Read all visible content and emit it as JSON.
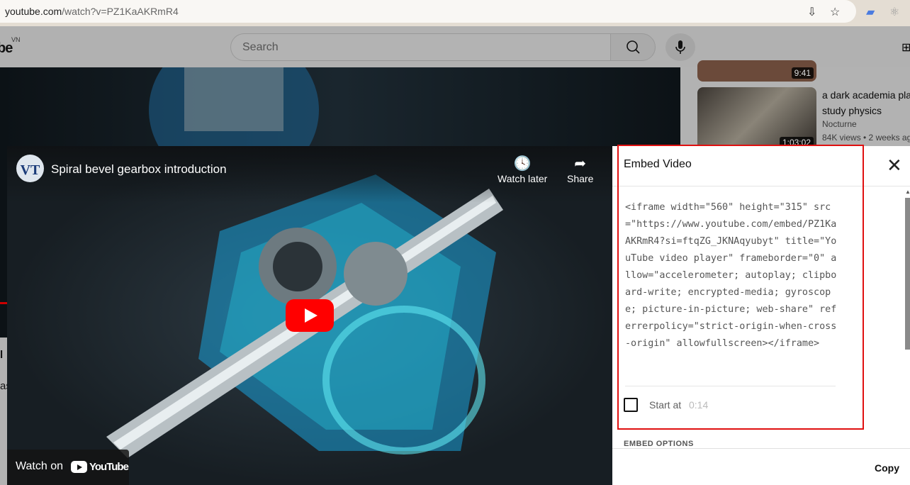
{
  "browser": {
    "url_host": "youtube.com",
    "url_path": "/watch?v=PZ1KaAKRmR4"
  },
  "header": {
    "logo": "be",
    "region": "VN",
    "search_placeholder": "Search"
  },
  "sidebar": [
    {
      "title": "",
      "meta": "",
      "duration": "9:41"
    },
    {
      "title": "a dark academia pla study physics",
      "channel": "Nocturne",
      "meta": "84K views • 2 weeks ag",
      "duration": "1:03:02"
    }
  ],
  "player": {
    "title": "Spiral bevel gearbox introduction",
    "channel_avatar": "VT",
    "watch_later": "Watch later",
    "share": "Share",
    "watch_on": "Watch on",
    "yt_logo": "YouTube"
  },
  "embed": {
    "title": "Embed Video",
    "code": "<iframe width=\"560\" height=\"315\" src=\"https://www.youtube.com/embed/PZ1KaAKRmR4?si=ftqZG_JKNAqyubyt\" title=\"YouTube video player\" frameborder=\"0\" allow=\"accelerometer; autoplay; clipboard-write; encrypted-media; gyroscope; picture-in-picture; web-share\" referrerpolicy=\"strict-origin-when-cross-origin\" allowfullscreen></iframe>",
    "start_label": "Start at",
    "start_value": "0:14",
    "start_checked": false,
    "options_label": "EMBED OPTIONS",
    "copy_label": "Copy"
  },
  "colors": {
    "highlight": "#e01010",
    "play": "#ff0000"
  }
}
